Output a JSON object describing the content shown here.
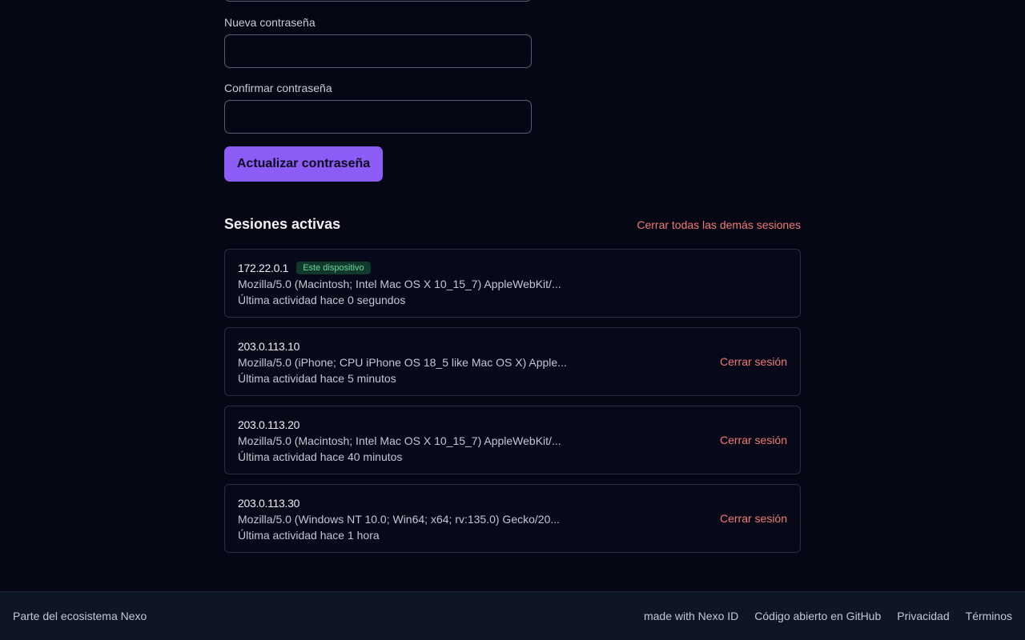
{
  "password_form": {
    "new_password_label": "Nueva contraseña",
    "new_password_value": "",
    "confirm_password_label": "Confirmar contraseña",
    "confirm_password_value": "",
    "submit_label": "Actualizar contraseña"
  },
  "sessions": {
    "title": "Sesiones activas",
    "logout_all_label": "Cerrar todas las demás sesiones",
    "items": [
      {
        "ip": "172.22.0.1",
        "badge": "Este dispositivo",
        "user_agent": "Mozilla/5.0 (Macintosh; Intel Mac OS X 10_15_7) AppleWebKit/...",
        "last_activity": "Última actividad hace 0 segundos"
      },
      {
        "ip": "203.0.113.10",
        "user_agent": "Mozilla/5.0 (iPhone; CPU iPhone OS 18_5 like Mac OS X) Apple...",
        "last_activity": "Última actividad hace 5 minutos",
        "logout_label": "Cerrar sesión"
      },
      {
        "ip": "203.0.113.20",
        "user_agent": "Mozilla/5.0 (Macintosh; Intel Mac OS X 10_15_7) AppleWebKit/...",
        "last_activity": "Última actividad hace 40 minutos",
        "logout_label": "Cerrar sesión"
      },
      {
        "ip": "203.0.113.30",
        "user_agent": "Mozilla/5.0 (Windows NT 10.0; Win64; x64; rv:135.0) Gecko/20...",
        "last_activity": "Última actividad hace 1 hora",
        "logout_label": "Cerrar sesión"
      }
    ]
  },
  "footer": {
    "left_text": "Parte del ecosistema Nexo",
    "links": [
      "made with Nexo ID",
      "Código abierto en GitHub",
      "Privacidad",
      "Términos"
    ]
  },
  "colors": {
    "background": "#050714",
    "accent": "#8b5cf6",
    "danger_link": "#f07a76",
    "badge_bg": "#0f3a2b",
    "badge_text": "#6fd3a1",
    "footer_bg": "#0e1626"
  }
}
